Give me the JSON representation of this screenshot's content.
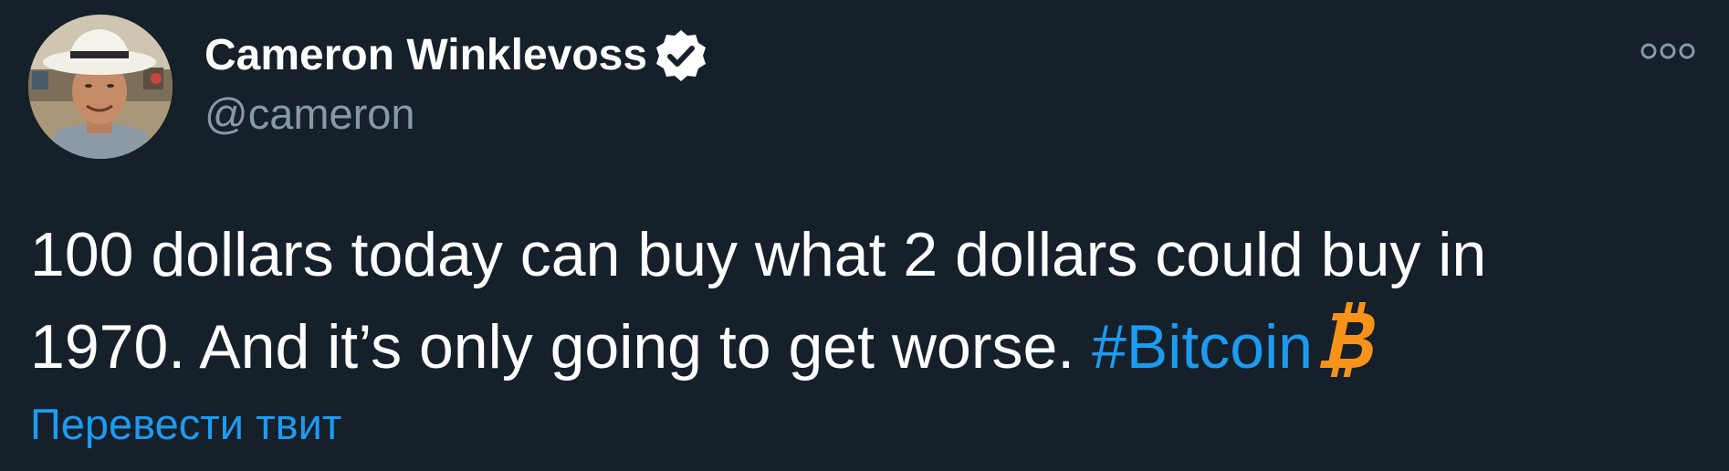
{
  "tweet": {
    "author": {
      "name": "Cameron Winklevoss",
      "handle": "@cameron",
      "verified": true,
      "avatar_icon": "profile-photo"
    },
    "text_line1": "100 dollars today can buy what 2 dollars could buy in",
    "text_line2_prefix": "1970. And it’s only going to get worse. ",
    "hashtag": "#Bitcoin",
    "emoji_icon": "bitcoin-icon",
    "translate_label": "Перевести твит",
    "more_icon": "more-options-icon"
  },
  "colors": {
    "background": "#15202b",
    "text_primary": "#ffffff",
    "text_secondary": "#8899a6",
    "link": "#1d9bf0",
    "bitcoin": "#f7931a"
  }
}
